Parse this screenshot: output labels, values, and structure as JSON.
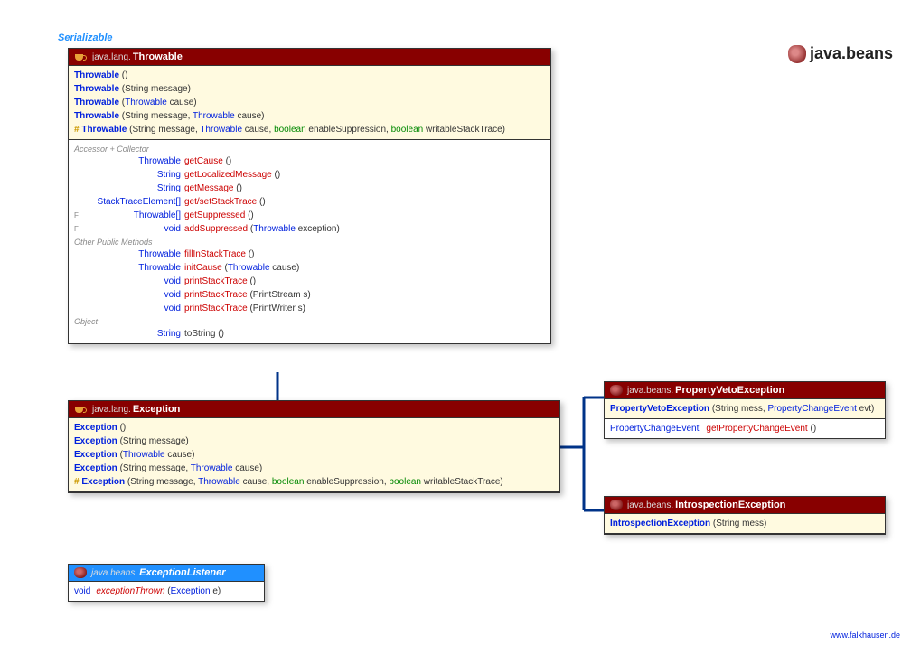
{
  "serializable": "Serializable",
  "packageTitle": "java.beans",
  "footer": "www.falkhausen.de",
  "throwable": {
    "pkg": "java.lang.",
    "cls": "Throwable",
    "ctors": [
      {
        "hash": "",
        "name": "Throwable",
        "params": "()"
      },
      {
        "hash": "",
        "name": "Throwable",
        "params": "(String message)"
      },
      {
        "hash": "",
        "name": "Throwable",
        "params_pre": "(",
        "typeA": "Throwable",
        "params_post": " cause)"
      },
      {
        "hash": "",
        "name": "Throwable",
        "params_pre": "(String message, ",
        "typeA": "Throwable",
        "params_post": " cause)"
      },
      {
        "hash": "# ",
        "name": "Throwable",
        "params_pre": "(String message, ",
        "typeA": "Throwable",
        "mid1": " cause, ",
        "kw1": "boolean",
        "mid2": " enableSuppression, ",
        "kw2": "boolean",
        "params_post": " writableStackTrace)"
      }
    ],
    "sec1": "Accessor + Collector",
    "m1": {
      "flag": "",
      "ret": "Throwable",
      "name": "getCause",
      "params": "()"
    },
    "m2": {
      "flag": "",
      "ret": "String",
      "name": "getLocalizedMessage",
      "params": "()"
    },
    "m3": {
      "flag": "",
      "ret": "String",
      "name": "getMessage",
      "params": "()"
    },
    "m4": {
      "flag": "",
      "ret": "StackTraceElement[]",
      "name": "get/setStackTrace",
      "params": "()"
    },
    "m5": {
      "flag": "F",
      "ret": "Throwable[]",
      "name": "getSuppressed",
      "params": "()"
    },
    "m6": {
      "flag": "F",
      "ret": "void",
      "name": "addSuppressed",
      "params_pre": "(",
      "typeA": "Throwable",
      "params_post": " exception)"
    },
    "sec2": "Other Public Methods",
    "m7": {
      "ret": "Throwable",
      "name": "fillInStackTrace",
      "params": "()"
    },
    "m8": {
      "ret": "Throwable",
      "name": "initCause",
      "params_pre": "(",
      "typeA": "Throwable",
      "params_post": " cause)"
    },
    "m9": {
      "ret": "void",
      "name": "printStackTrace",
      "params": "()"
    },
    "m10": {
      "ret": "void",
      "name": "printStackTrace",
      "params": "(PrintStream s)"
    },
    "m11": {
      "ret": "void",
      "name": "printStackTrace",
      "params": "(PrintWriter s)"
    },
    "sec3": "Object",
    "m12": {
      "ret": "String",
      "name": "toString",
      "params": "()"
    }
  },
  "exception": {
    "pkg": "java.lang.",
    "cls": "Exception",
    "ctors": [
      {
        "hash": "",
        "name": "Exception",
        "params": "()"
      },
      {
        "hash": "",
        "name": "Exception",
        "params": "(String message)"
      },
      {
        "hash": "",
        "name": "Exception",
        "params_pre": "(",
        "typeA": "Throwable",
        "params_post": " cause)"
      },
      {
        "hash": "",
        "name": "Exception",
        "params_pre": "(String message, ",
        "typeA": "Throwable",
        "params_post": " cause)"
      },
      {
        "hash": "# ",
        "name": "Exception",
        "params_pre": "(String message, ",
        "typeA": "Throwable",
        "mid1": " cause, ",
        "kw1": "boolean",
        "mid2": " enableSuppression, ",
        "kw2": "boolean",
        "params_post": " writableStackTrace)"
      }
    ]
  },
  "pve": {
    "pkg": "java.beans.",
    "cls": "PropertyVetoException",
    "ctor": {
      "name": "PropertyVetoException",
      "params_pre": "(String mess, ",
      "typeA": "PropertyChangeEvent",
      "params_post": " evt)"
    },
    "m1": {
      "ret": "PropertyChangeEvent",
      "name": "getPropertyChangeEvent",
      "params": "()"
    }
  },
  "ie": {
    "pkg": "java.beans.",
    "cls": "IntrospectionException",
    "ctor": {
      "name": "IntrospectionException",
      "params": "(String mess)"
    }
  },
  "el": {
    "pkg": "java.beans.",
    "cls": "ExceptionListener",
    "m1": {
      "ret": "void",
      "name": "exceptionThrown",
      "params_pre": "(",
      "typeA": "Exception",
      "params_post": " e)"
    }
  }
}
